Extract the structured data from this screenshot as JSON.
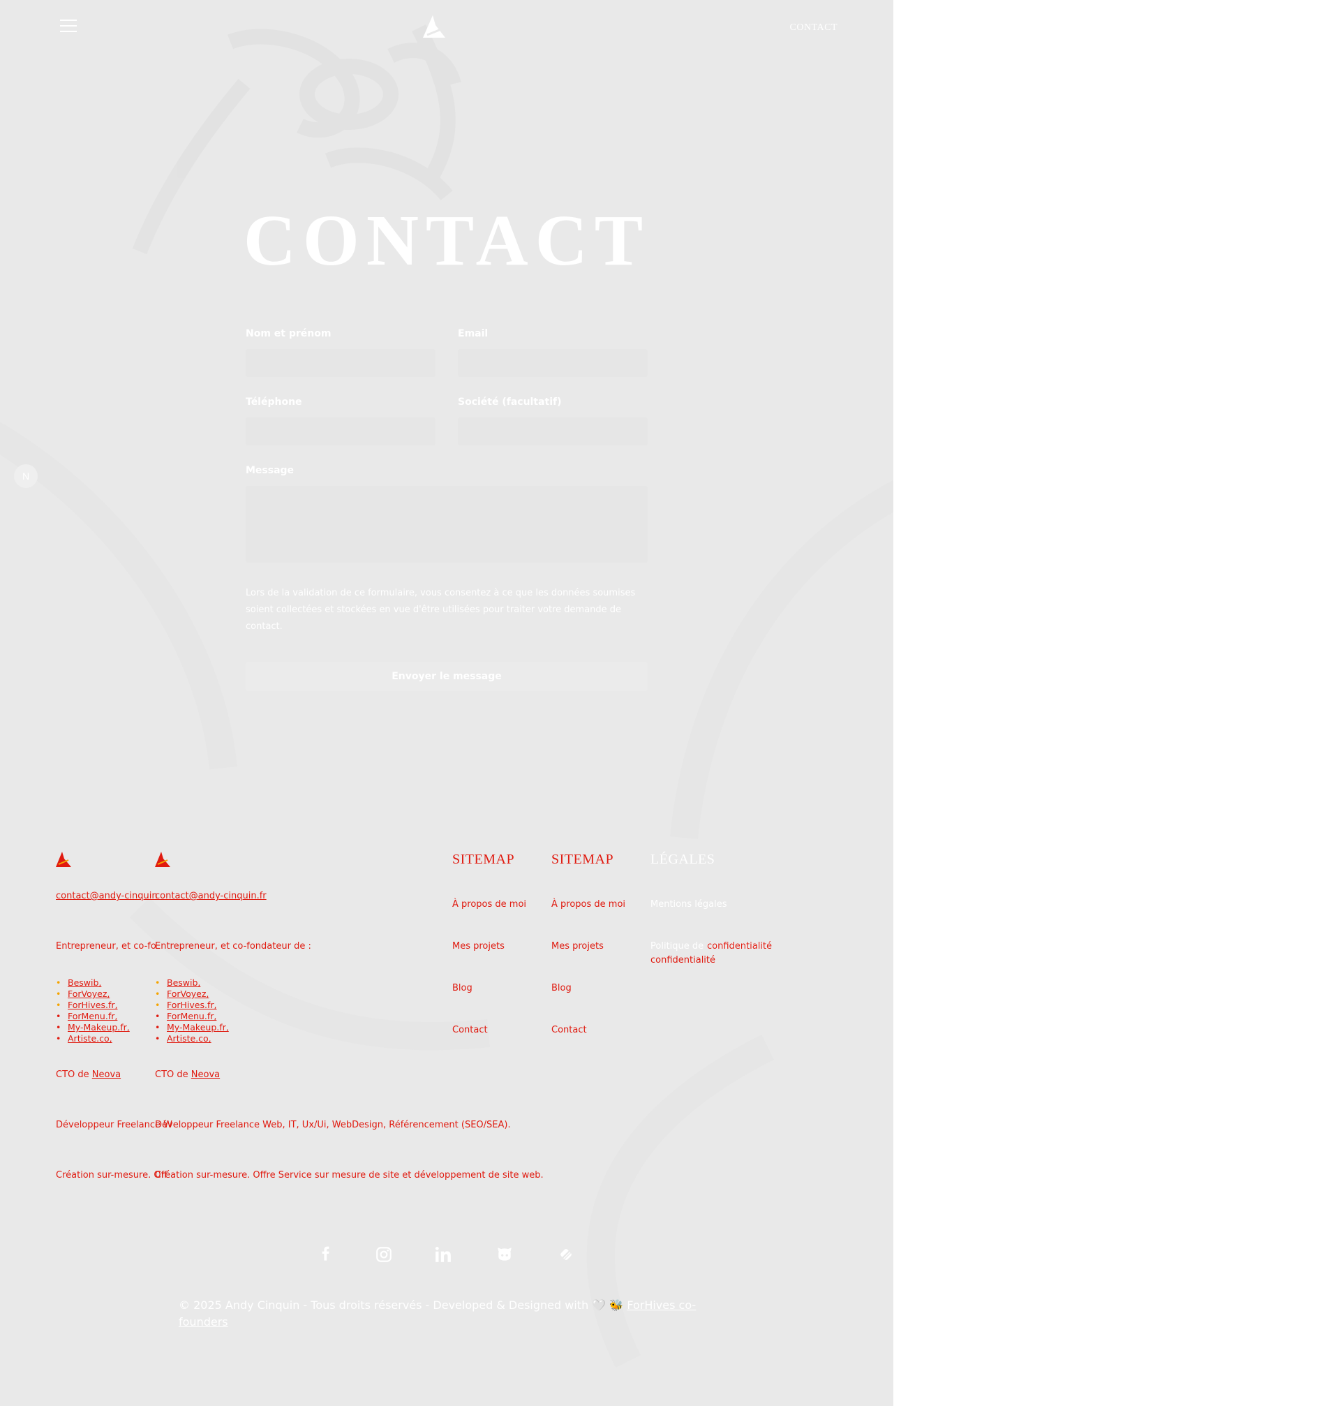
{
  "header": {
    "nav_contact": "CONTACT",
    "side_badge": "N"
  },
  "hero": {
    "title": "CONTACT"
  },
  "form": {
    "name_label": "Nom et prénom",
    "email_label": "Email",
    "phone_label": "Téléphone",
    "company_label": "Société (facultatif)",
    "message_label": "Message",
    "name_value": "",
    "email_value": "",
    "phone_value": "",
    "company_value": "",
    "message_value": "",
    "consent": "Lors de la validation de ce formulaire, vous consentez à ce que les données soumises soient collectées et stockées en vue d'être utilisées pour traiter votre demande de contact.",
    "submit_label": "Envoyer le message"
  },
  "footer": {
    "email": "contact@andy-cinquin.fr",
    "email_clipped": "contact@andy-cinquin",
    "intro": "Entrepreneur, et co-fondateur de :",
    "intro_clipped": "Entrepreneur, et co-fo",
    "companies": [
      "Beswib,",
      "ForVoyez,",
      "ForHives.fr,",
      "ForMenu.fr,",
      "My-Makeup.fr,",
      "Artiste.co,"
    ],
    "cto_prefix": "CTO de",
    "cto_company": "Neova",
    "dev_text": "Développeur Freelance Web, IT, Ux/Ui, WebDesign, Référencement (SEO/SEA).",
    "dev_clipped": "Développeur Freelance W",
    "creation_text": "Création sur-mesure. Offre Service sur mesure de site et développement de site web.",
    "creation_clipped": "Création sur-mesure. Off",
    "sitemap_title": "SITEMAP",
    "sitemap_links": [
      "À propos de moi",
      "Mes projets",
      "Blog",
      "Contact"
    ],
    "legal_title": "LÉGALES",
    "legal_links": [
      "Mentions légales",
      "Politique de confidentialité"
    ],
    "legal_word": "confidentialité",
    "copyright": "© 2025 Andy Cinquin - Tous droits réservés - Developed & Designed with 🤍 🐝",
    "copyright_link": "ForHives co-founders",
    "social_icons": [
      "facebook-icon",
      "instagram-icon",
      "linkedin-icon",
      "github-icon",
      "malt-icon"
    ]
  },
  "colors": {
    "page_bg": "#e9e9e9",
    "accent_red": "#e01a0f",
    "accent_orange": "#f5a400",
    "text_white": "#ffffff"
  }
}
